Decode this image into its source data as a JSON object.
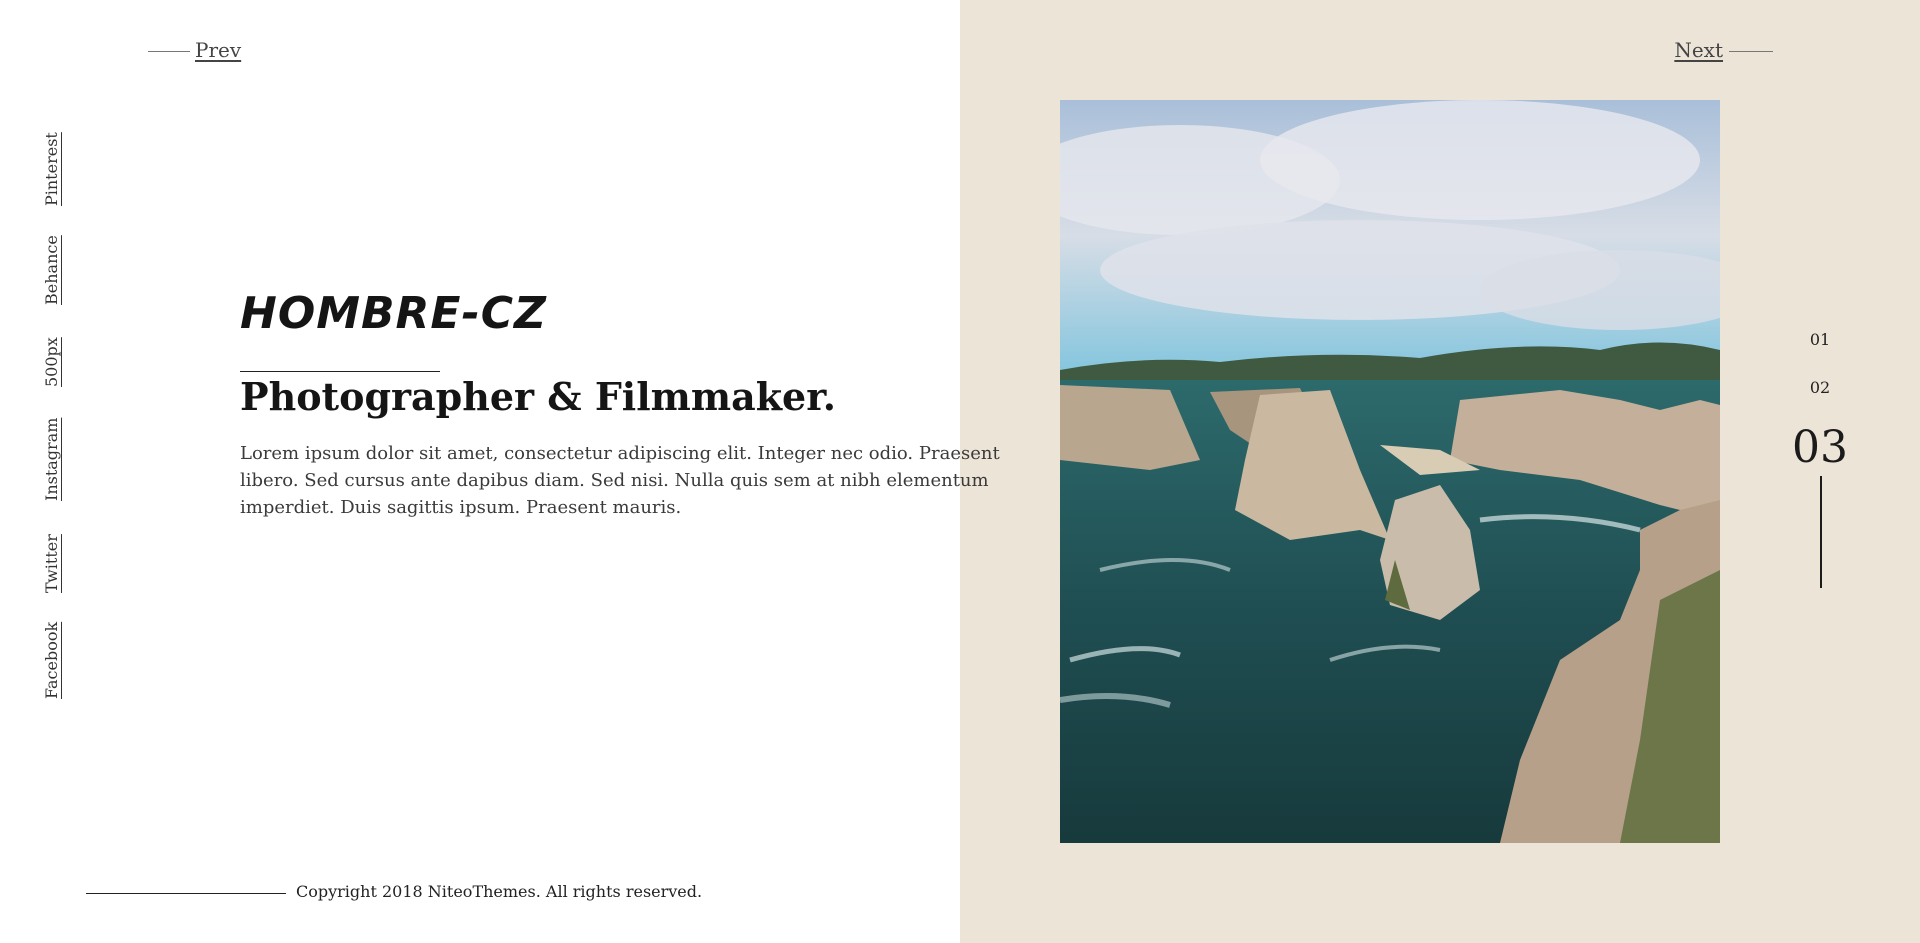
{
  "nav": {
    "prev_label": "Prev",
    "next_label": "Next"
  },
  "social": [
    {
      "label": "Pinterest"
    },
    {
      "label": "Behance"
    },
    {
      "label": "500px"
    },
    {
      "label": "Instagram"
    },
    {
      "label": "Twitter"
    },
    {
      "label": "Facebook"
    }
  ],
  "hero": {
    "logo": "HOMBRE-CZ",
    "headline": "Photographer & Filmmaker.",
    "body": "Lorem ipsum dolor sit amet, consectetur adipiscing elit. Integer nec odio. Praesent libero. Sed cursus ante dapibus diam. Sed nisi. Nulla quis sem at nibh elementum imperdiet. Duis sagittis ipsum. Praesent mauris."
  },
  "footer": {
    "copyright": "Copyright 2018 NiteoThemes. All rights reserved."
  },
  "slides": {
    "items": [
      "01",
      "02"
    ],
    "current": "03"
  },
  "colors": {
    "right_panel_bg": "#ede4d8",
    "text": "#1b1b1b"
  }
}
